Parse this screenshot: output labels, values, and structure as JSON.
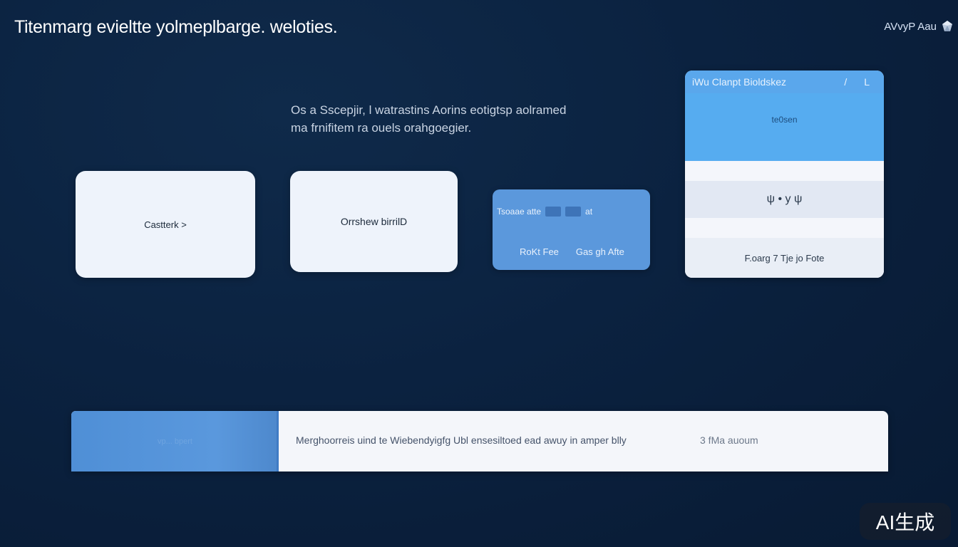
{
  "header": {
    "title": "Titenmarg evieltte yolmeplbarge. weloties.",
    "brand": "AVvyP Aau"
  },
  "description": {
    "line1": "Os a Sscepjir, l watrastins Aorins eotigtsp aolramed",
    "line2": "ma frnifitem ra ouels orahgoegier."
  },
  "cards": [
    {
      "label": "Castterk >"
    },
    {
      "label": "Orrshew birrilD"
    }
  ],
  "blue_card": {
    "row1_text": "Tsoaae atte",
    "row1_suffix": "at",
    "left_label": "RoKt Fee",
    "right_label": "Gas gh Afte"
  },
  "panel": {
    "title": "iWu Clanpt Bioldskez",
    "controls": "/ L",
    "hero_label": "te0sen",
    "mid_glyphs": "ψ • y ψ",
    "footer_label": "F.oarg 7 Tje jo Fote"
  },
  "bottom_bar": {
    "left_label": "vp... bpert",
    "text": "Merghoorreis uind te Wiebendyigfg Ubl ensesiltoed ead awuy in amper blly",
    "meta": "3 fMa auoum"
  },
  "watermark": "AI生成",
  "colors": {
    "background": "#0b2240",
    "accent_blue": "#5b98dc",
    "panel_header": "#5aa7ec",
    "card_bg": "#eef3fb"
  }
}
